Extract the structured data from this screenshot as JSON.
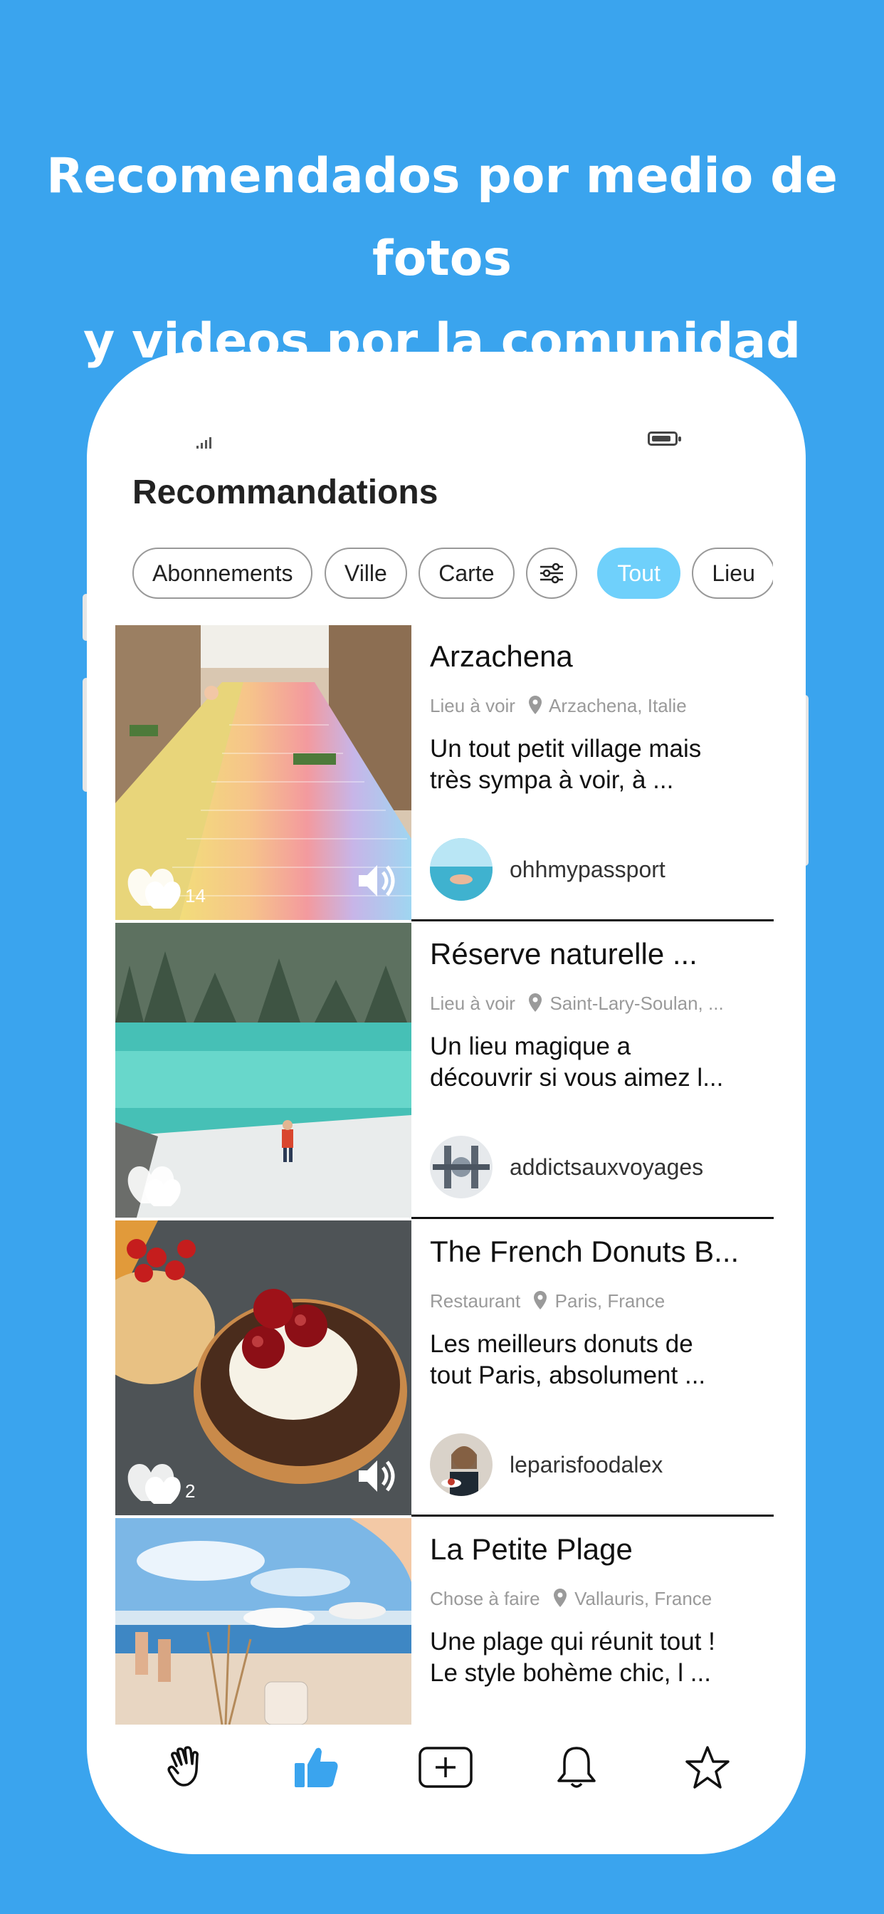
{
  "promo": {
    "line1": "Recomendados por medio de fotos",
    "line2": "y videos por la comunidad"
  },
  "screen_title": "Recommandations",
  "filters": [
    "Abonnements",
    "Ville",
    "Carte",
    "Tout",
    "Lieu"
  ],
  "filter_active": "Tout",
  "cards": [
    {
      "title": "Arzachena",
      "category": "Lieu à voir",
      "location": "Arzachena, Italie",
      "desc1": "Un tout petit village mais",
      "desc2": "très sympa à voir, à ...",
      "user": "ohhmypassport",
      "likes": "14"
    },
    {
      "title": "Réserve naturelle ...",
      "category": "Lieu à voir",
      "location": "Saint-Lary-Soulan, ...",
      "desc1": "Un lieu magique a",
      "desc2": "découvrir si vous aimez l...",
      "user": "addictsauxvoyages",
      "likes": ""
    },
    {
      "title": "The French Donuts B...",
      "category": "Restaurant",
      "location": "Paris, France",
      "desc1": "Les meilleurs donuts de",
      "desc2": "tout Paris, absolument ...",
      "user": "leparisfoodalex",
      "likes": "2"
    },
    {
      "title": "La Petite Plage",
      "category": "Chose à faire",
      "location": "Vallauris, France",
      "desc1": "Une plage qui réunit tout !",
      "desc2": "Le style bohème chic, l ...",
      "user": "",
      "likes": ""
    }
  ],
  "tabs": [
    "hand-wave-icon",
    "thumbs-up-icon",
    "add-post-icon",
    "bell-icon",
    "star-icon"
  ],
  "colors": {
    "background": "#3aa4ee",
    "accent": "#6fd0fb",
    "active_tab": "#3aa4ee"
  }
}
